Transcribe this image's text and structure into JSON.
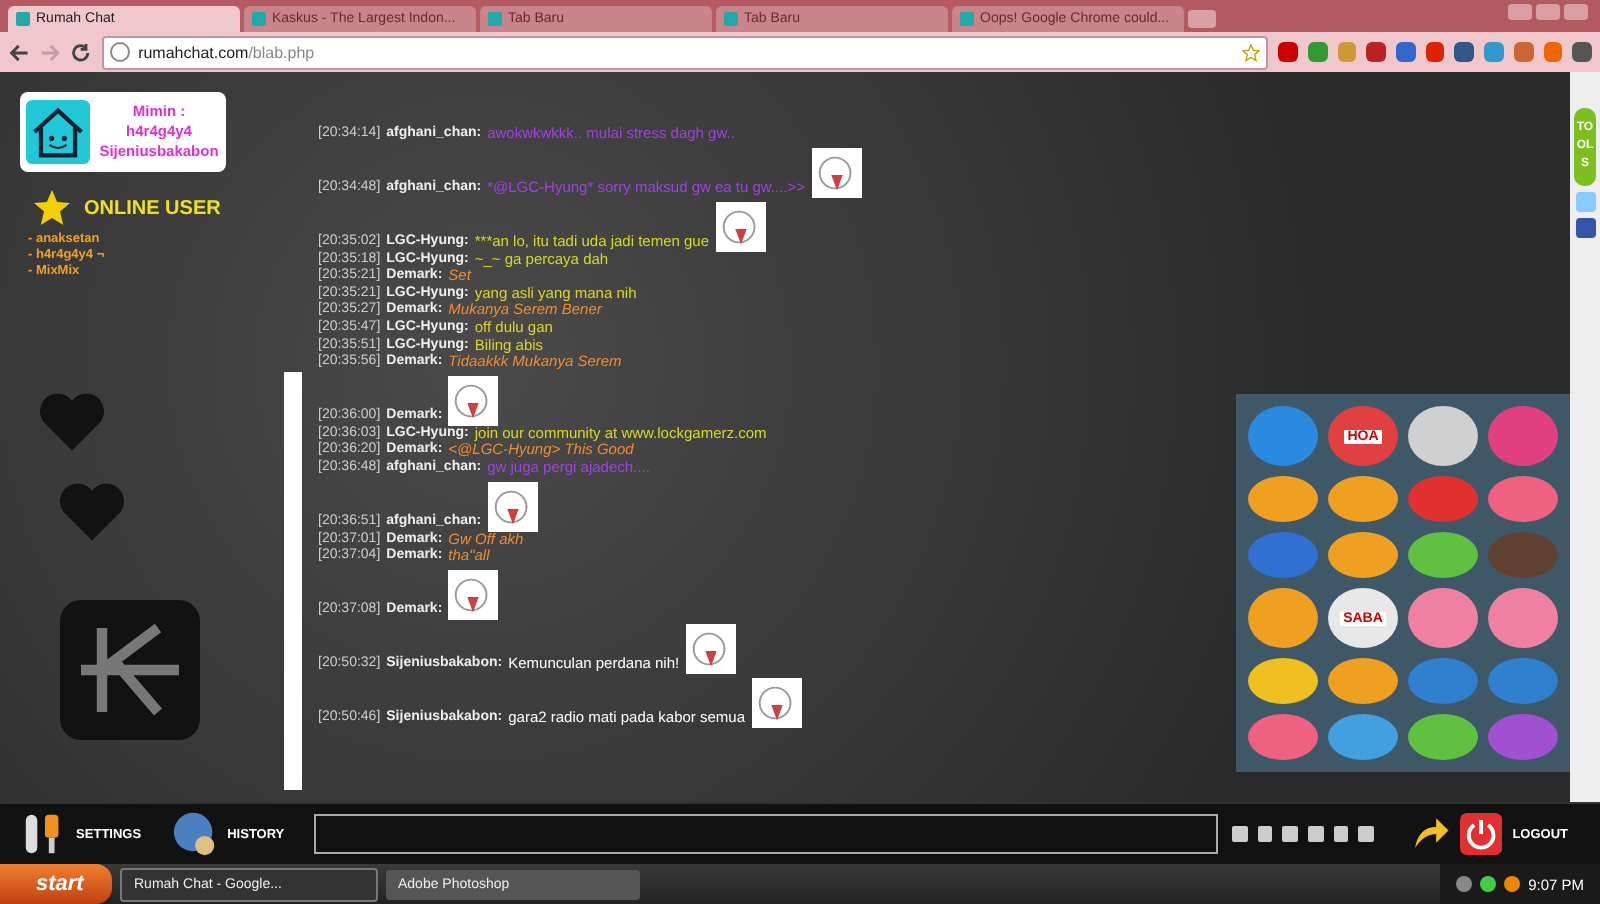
{
  "browser": {
    "tabs": [
      {
        "title": "Rumah Chat",
        "selected": true
      },
      {
        "title": "Kaskus - The Largest Indon...",
        "selected": false
      },
      {
        "title": "Tab Baru",
        "selected": false
      },
      {
        "title": "Tab Baru",
        "selected": false
      },
      {
        "title": "Oops! Google Chrome could...",
        "selected": false
      }
    ],
    "url": {
      "host": "rumahchat.com",
      "path": "/blab.php"
    }
  },
  "sidebar": {
    "admin_label": "Mimin :",
    "admins": [
      "h4r4g4y4",
      "Sijeniusbakabon"
    ],
    "online_title": "ONLINE USER",
    "online_users": [
      "- anaksetan",
      "- h4r4g4y4 ¬",
      "- MixMix"
    ]
  },
  "messages": [
    {
      "time": "[20:34:14]",
      "user": "afghani_chan:",
      "text": "awokwkwkkk.. mulai stress dagh gw..",
      "color": "#a040e0",
      "italic": false,
      "sticker": false
    },
    {
      "time": "[20:34:48]",
      "user": "afghani_chan:",
      "text": "*@LGC-Hyung* sorry maksud gw ea tu gw....>>",
      "color": "#a040e0",
      "italic": false,
      "sticker": true
    },
    {
      "time": "[20:35:02]",
      "user": "LGC-Hyung:",
      "text": "***an lo, itu tadi uda jadi temen gue",
      "color": "#d8d820",
      "italic": false,
      "sticker": true
    },
    {
      "time": "[20:35:18]",
      "user": "LGC-Hyung:",
      "text": "~_~ ga percaya dah",
      "color": "#d8d820",
      "italic": false,
      "sticker": false
    },
    {
      "time": "[20:35:21]",
      "user": "Demark:",
      "text": "Set",
      "color": "#f08c30",
      "italic": true,
      "sticker": false
    },
    {
      "time": "[20:35:21]",
      "user": "LGC-Hyung:",
      "text": "yang asli yang mana nih",
      "color": "#d8d820",
      "italic": false,
      "sticker": false
    },
    {
      "time": "[20:35:27]",
      "user": "Demark:",
      "text": "Mukanya Serem Bener",
      "color": "#f08c30",
      "italic": true,
      "sticker": false
    },
    {
      "time": "[20:35:47]",
      "user": "LGC-Hyung:",
      "text": "off dulu gan",
      "color": "#d8d820",
      "italic": false,
      "sticker": false
    },
    {
      "time": "[20:35:51]",
      "user": "LGC-Hyung:",
      "text": "Biling abis",
      "color": "#d8d820",
      "italic": false,
      "sticker": false
    },
    {
      "time": "[20:35:56]",
      "user": "Demark:",
      "text": "Tidaakkk Mukanya Serem",
      "color": "#f08c30",
      "italic": true,
      "sticker": false
    },
    {
      "time": "[20:36:00]",
      "user": "Demark:",
      "sticker": true
    },
    {
      "time": "[20:36:03]",
      "user": "LGC-Hyung:",
      "text": "join our community at www.lockgamerz.com",
      "color": "#d8d820",
      "italic": false,
      "sticker": false
    },
    {
      "time": "[20:36:20]",
      "user": "Demark:",
      "text": "<@LGC-Hyung> This Good",
      "color": "#f08c30",
      "italic": true,
      "sticker": false
    },
    {
      "time": "[20:36:48]",
      "user": "afghani_chan:",
      "text": "gw juga pergi ajadech....",
      "color": "#a040e0",
      "italic": false,
      "sticker": false
    },
    {
      "time": "[20:36:51]",
      "user": "afghani_chan:",
      "sticker": true
    },
    {
      "time": "[20:37:01]",
      "user": "Demark:",
      "text": "Gw Off akh",
      "color": "#f08c30",
      "italic": true,
      "sticker": false
    },
    {
      "time": "[20:37:04]",
      "user": "Demark:",
      "text": "tha\"all",
      "color": "#f08c30",
      "italic": true,
      "sticker": false
    },
    {
      "time": "[20:37:08]",
      "user": "Demark:",
      "sticker": true
    },
    {
      "time": "[20:50:32]",
      "user": "Sijeniusbakabon:",
      "text": "Kemunculan perdana nih!",
      "color": "#ffffff",
      "italic": false,
      "sticker": true
    },
    {
      "time": "[20:50:46]",
      "user": "Sijeniusbakabon:",
      "text": "gara2 radio mati pada kabor semua",
      "color": "#ffffff",
      "italic": false,
      "sticker": true
    }
  ],
  "tools_tab": "TOOLS",
  "emoticon_captions": [
    "HOA",
    "SABA"
  ],
  "bottom_bar": {
    "settings": "SETTINGS",
    "history": "HISTORY",
    "logout": "LOGOUT"
  },
  "taskbar": {
    "start": "start",
    "tasks": [
      {
        "title": "Rumah Chat - Google...",
        "selected": true
      },
      {
        "title": "Adobe Photoshop",
        "selected": false
      }
    ],
    "clock": "9:07 PM"
  }
}
